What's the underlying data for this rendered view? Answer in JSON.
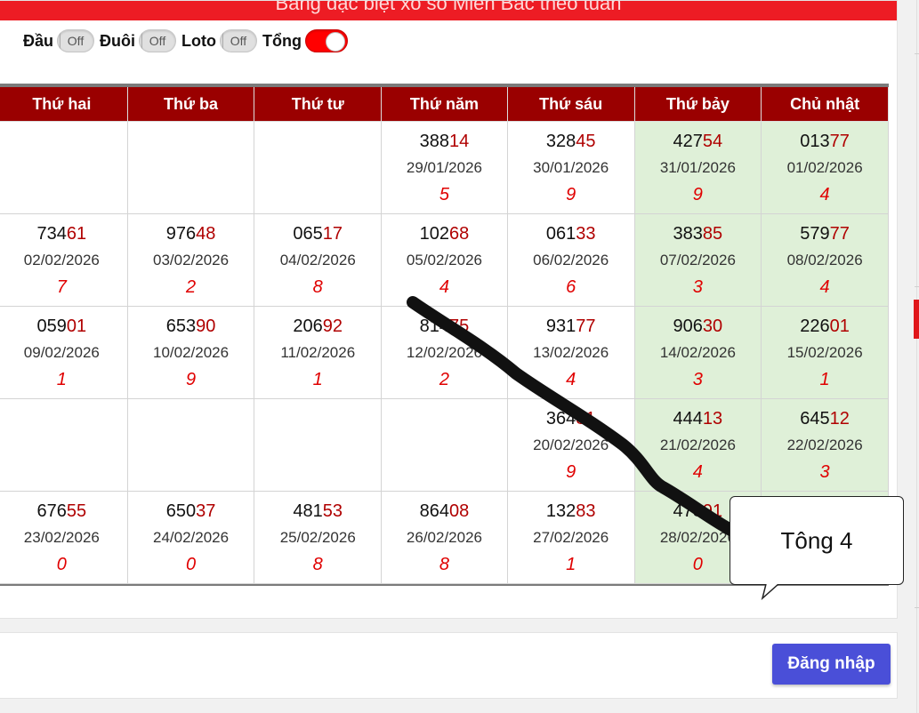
{
  "header": {
    "title": "Bảng đặc biệt xổ số Miền Bắc theo tuần"
  },
  "toggles": [
    {
      "label": "Đầu",
      "state": "Off",
      "on": false
    },
    {
      "label": "Đuôi",
      "state": "Off",
      "on": false
    },
    {
      "label": "Loto",
      "state": "Off",
      "on": false
    },
    {
      "label": "Tổng",
      "state": "",
      "on": true
    }
  ],
  "table": {
    "columns": [
      "Thứ hai",
      "Thứ ba",
      "Thứ tư",
      "Thứ năm",
      "Thứ sáu",
      "Thứ bảy",
      "Chủ nhật"
    ],
    "rows": [
      [
        null,
        null,
        null,
        {
          "prefix": "388",
          "tail": "14",
          "date": "29/01/2026",
          "sum": "5"
        },
        {
          "prefix": "328",
          "tail": "45",
          "date": "30/01/2026",
          "sum": "9"
        },
        {
          "prefix": "427",
          "tail": "54",
          "date": "31/01/2026",
          "sum": "9"
        },
        {
          "prefix": "013",
          "tail": "77",
          "date": "01/02/2026",
          "sum": "4"
        }
      ],
      [
        {
          "prefix": "734",
          "tail": "61",
          "date": "02/02/2026",
          "sum": "7"
        },
        {
          "prefix": "976",
          "tail": "48",
          "date": "03/02/2026",
          "sum": "2"
        },
        {
          "prefix": "065",
          "tail": "17",
          "date": "04/02/2026",
          "sum": "8"
        },
        {
          "prefix": "102",
          "tail": "68",
          "date": "05/02/2026",
          "sum": "4"
        },
        {
          "prefix": "061",
          "tail": "33",
          "date": "06/02/2026",
          "sum": "6"
        },
        {
          "prefix": "383",
          "tail": "85",
          "date": "07/02/2026",
          "sum": "3"
        },
        {
          "prefix": "579",
          "tail": "77",
          "date": "08/02/2026",
          "sum": "4"
        }
      ],
      [
        {
          "prefix": "059",
          "tail": "01",
          "date": "09/02/2026",
          "sum": "1"
        },
        {
          "prefix": "653",
          "tail": "90",
          "date": "10/02/2026",
          "sum": "9"
        },
        {
          "prefix": "206",
          "tail": "92",
          "date": "11/02/2026",
          "sum": "1"
        },
        {
          "prefix": "814",
          "tail": "75",
          "date": "12/02/2026",
          "sum": "2"
        },
        {
          "prefix": "931",
          "tail": "77",
          "date": "13/02/2026",
          "sum": "4"
        },
        {
          "prefix": "906",
          "tail": "30",
          "date": "14/02/2026",
          "sum": "3"
        },
        {
          "prefix": "226",
          "tail": "01",
          "date": "15/02/2026",
          "sum": "1"
        }
      ],
      [
        null,
        null,
        null,
        null,
        {
          "prefix": "364",
          "tail": "81",
          "date": "20/02/2026",
          "sum": "9"
        },
        {
          "prefix": "444",
          "tail": "13",
          "date": "21/02/2026",
          "sum": "4"
        },
        {
          "prefix": "645",
          "tail": "12",
          "date": "22/02/2026",
          "sum": "3"
        }
      ],
      [
        {
          "prefix": "676",
          "tail": "55",
          "date": "23/02/2026",
          "sum": "0"
        },
        {
          "prefix": "650",
          "tail": "37",
          "date": "24/02/2026",
          "sum": "0"
        },
        {
          "prefix": "481",
          "tail": "53",
          "date": "25/02/2026",
          "sum": "8"
        },
        {
          "prefix": "864",
          "tail": "08",
          "date": "26/02/2026",
          "sum": "8"
        },
        {
          "prefix": "132",
          "tail": "83",
          "date": "27/02/2026",
          "sum": "1"
        },
        {
          "prefix": "478",
          "tail": "91",
          "date": "28/02/2026",
          "sum": "0"
        },
        null
      ]
    ]
  },
  "annotation": {
    "text": "Tông 4"
  },
  "login": {
    "label": "Đăng nhập"
  },
  "colors": {
    "header_red": "#ed1c24",
    "column_header": "#9a0000",
    "weekend_bg": "#dff0d8",
    "sum_red": "#e00000",
    "login_blue": "#4a4fd8"
  }
}
